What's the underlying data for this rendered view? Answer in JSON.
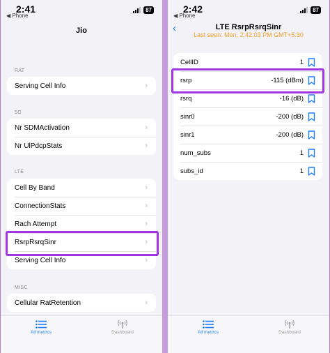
{
  "left": {
    "status": {
      "time": "2:41",
      "back": "◀ Phone",
      "battery": "87"
    },
    "title": "Jio",
    "sections": [
      {
        "header": "RAT",
        "items": [
          "Serving Cell Info"
        ]
      },
      {
        "header": "5G",
        "items": [
          "Nr SDMActivation",
          "Nr UlPdcpStats"
        ]
      },
      {
        "header": "LTE",
        "items": [
          "Cell By Band",
          "ConnectionStats",
          "Rach Attempt",
          "RsrpRsrqSinr",
          "Serving Cell Info"
        ]
      },
      {
        "header": "MISC",
        "items": [
          "Cellular RatRetention"
        ]
      }
    ],
    "tabs": {
      "metrics": "All metrics",
      "dashboard": "Dashboard"
    }
  },
  "right": {
    "status": {
      "time": "2:42",
      "back": "◀ Phone",
      "battery": "87"
    },
    "title": "LTE RsrpRsrqSinr",
    "subtitle": "Last seen: Mon, 2:42:03 PM GMT+5:30",
    "rows": [
      {
        "label": "CellID",
        "value": "1"
      },
      {
        "label": "rsrp",
        "value": "-115 (dBm)"
      },
      {
        "label": "rsrq",
        "value": "-16 (dB)"
      },
      {
        "label": "sinr0",
        "value": "-200 (dB)"
      },
      {
        "label": "sinr1",
        "value": "-200 (dB)"
      },
      {
        "label": "num_subs",
        "value": "1"
      },
      {
        "label": "subs_id",
        "value": "1"
      }
    ],
    "tabs": {
      "metrics": "All metrics",
      "dashboard": "Dashboard"
    }
  },
  "colors": {
    "accent": "#1a7cf5",
    "highlight": "#a236e3",
    "subtitle": "#f0a024"
  }
}
